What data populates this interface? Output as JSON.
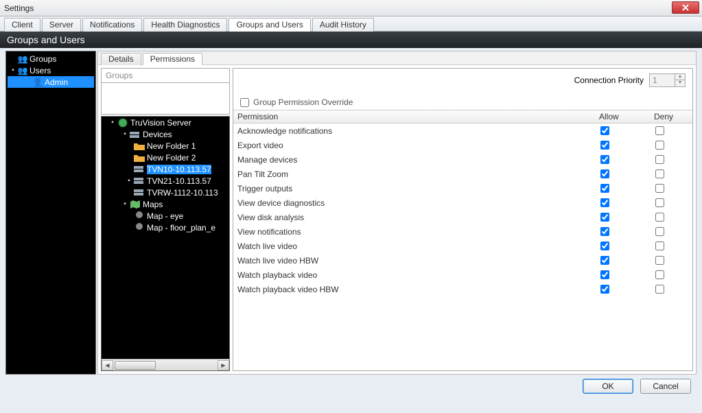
{
  "window": {
    "title": "Settings"
  },
  "mainTabs": [
    "Client",
    "Server",
    "Notifications",
    "Health Diagnostics",
    "Groups and Users",
    "Audit History"
  ],
  "mainTabActive": 4,
  "sectionHeader": "Groups and Users",
  "sidebarTree": {
    "groups_label": "Groups",
    "users_label": "Users",
    "admin_label": "Admin"
  },
  "subTabs": [
    "Details",
    "Permissions"
  ],
  "subTabActive": 1,
  "groupsHeader": "Groups",
  "connectionPriority": {
    "label": "Connection Priority",
    "value": "1"
  },
  "overrideLabel": "Group Permission Override",
  "deviceTree": {
    "root": "TruVision Server",
    "devices": "Devices",
    "folder1": "New Folder 1",
    "folder2": "New Folder 2",
    "tvn10": "TVN10-10.113.57",
    "tvn21": "TVN21-10.113.57",
    "tvrw": "TVRW-1112-10.113",
    "maps": "Maps",
    "map1": "Map - eye",
    "map2": "Map - floor_plan_e"
  },
  "permTable": {
    "col_permission": "Permission",
    "col_allow": "Allow",
    "col_deny": "Deny",
    "rows": [
      {
        "label": "Acknowledge notifications",
        "allow": true,
        "deny": false
      },
      {
        "label": "Export video",
        "allow": true,
        "deny": false
      },
      {
        "label": "Manage devices",
        "allow": true,
        "deny": false
      },
      {
        "label": "Pan Tilt Zoom",
        "allow": true,
        "deny": false
      },
      {
        "label": "Trigger outputs",
        "allow": true,
        "deny": false
      },
      {
        "label": "View device diagnostics",
        "allow": true,
        "deny": false
      },
      {
        "label": "View disk analysis",
        "allow": true,
        "deny": false
      },
      {
        "label": "View notifications",
        "allow": true,
        "deny": false
      },
      {
        "label": "Watch live video",
        "allow": true,
        "deny": false
      },
      {
        "label": "Watch live video HBW",
        "allow": true,
        "deny": false
      },
      {
        "label": "Watch playback video",
        "allow": true,
        "deny": false
      },
      {
        "label": "Watch playback video HBW",
        "allow": true,
        "deny": false
      }
    ]
  },
  "buttons": {
    "ok": "OK",
    "cancel": "Cancel"
  }
}
